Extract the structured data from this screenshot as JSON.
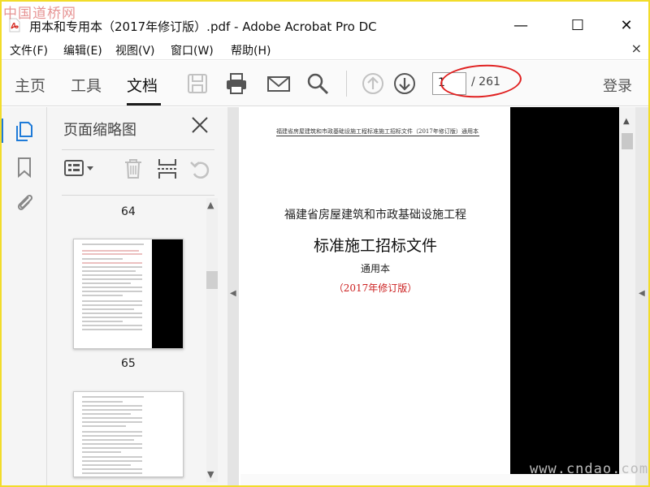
{
  "watermark_top": "中国道桥网",
  "watermark_bottom": "www.cndao.com",
  "window": {
    "title": "用本和专用本（2017年修订版）.pdf - Adobe Acrobat Pro DC",
    "minimize": "—",
    "maximize": "☐",
    "close": "✕"
  },
  "menu": {
    "items": [
      "文件(F)",
      "编辑(E)",
      "视图(V)",
      "窗口(W)",
      "帮助(H)"
    ],
    "close": "×"
  },
  "toolbar": {
    "tabs": [
      "主页",
      "工具",
      "文档"
    ],
    "active_tab": "文档",
    "current_page": "1",
    "total_pages": "/ 261",
    "login": "登录"
  },
  "thumbnail_panel": {
    "title": "页面缩略图",
    "pages": [
      "64",
      "65"
    ]
  },
  "document": {
    "header_left": "福建省房屋建筑和市政基础设施工程标准施工招标文件（2017年修订版）",
    "header_right": "通用本",
    "line1": "福建省房屋建筑和市政基础设施工程",
    "line2": "标准施工招标文件",
    "line3": "通用本",
    "line4": "（2017年修订版）"
  },
  "colors": {
    "accent": "#1f7bd8",
    "highlight_ellipse": "#e02020",
    "revision_text": "#cc2222",
    "frame": "#f2dc2a"
  }
}
